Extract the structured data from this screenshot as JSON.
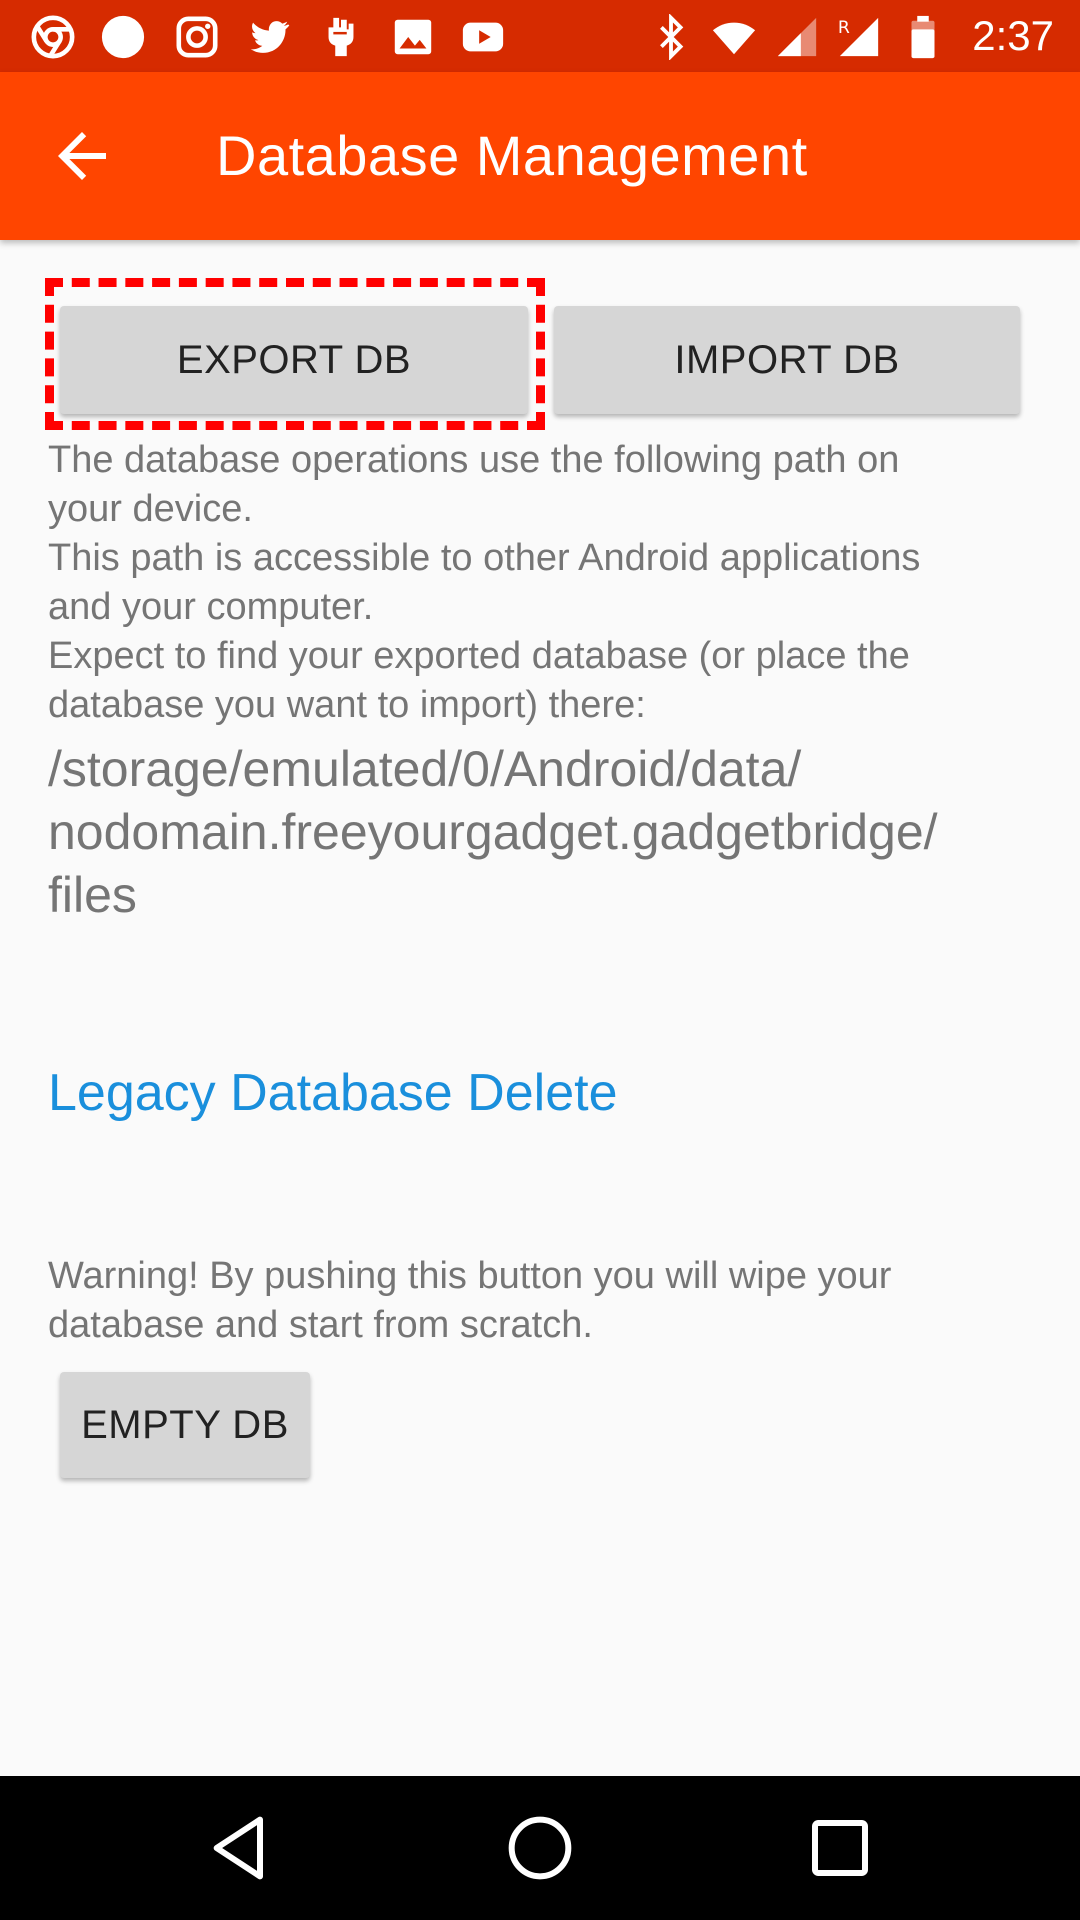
{
  "status_bar": {
    "time": "2:37",
    "background": "#d62b00",
    "left_icons": [
      "chrome-icon",
      "circle-app-icon",
      "instagram-icon",
      "twitter-icon",
      "fist-icon",
      "image-icon",
      "youtube-icon"
    ],
    "right_icons": [
      "bluetooth-icon",
      "wifi-icon",
      "cell-signal-icon",
      "roaming-signal-icon",
      "battery-icon"
    ]
  },
  "app_bar": {
    "title": "Database Management",
    "background": "#ff4500",
    "back_icon": "arrow-back-icon"
  },
  "buttons": {
    "export_label": "EXPORT DB",
    "import_label": "IMPORT DB",
    "empty_label": "EMPTY DB"
  },
  "info": {
    "lines": [
      "The database operations use the following path on",
      "your device.",
      "This path is accessible to other Android applications",
      "and your computer.",
      "Expect to find your exported database (or place the",
      "database you want to import) there:"
    ]
  },
  "path": {
    "lines": [
      "/storage/emulated/0/Android/data/",
      "nodomain.freeyourgadget.gadgetbridge/",
      "files"
    ]
  },
  "legacy": {
    "link_label": "Legacy Database Delete",
    "color": "#1a8fdc"
  },
  "warning": {
    "lines": [
      "Warning! By pushing this button you will wipe your",
      "database and start from scratch."
    ]
  },
  "highlight": {
    "color": "#ff0000",
    "target": "export-button"
  },
  "nav_bar": {
    "icons": [
      "nav-back-icon",
      "nav-home-icon",
      "nav-recents-icon"
    ]
  }
}
